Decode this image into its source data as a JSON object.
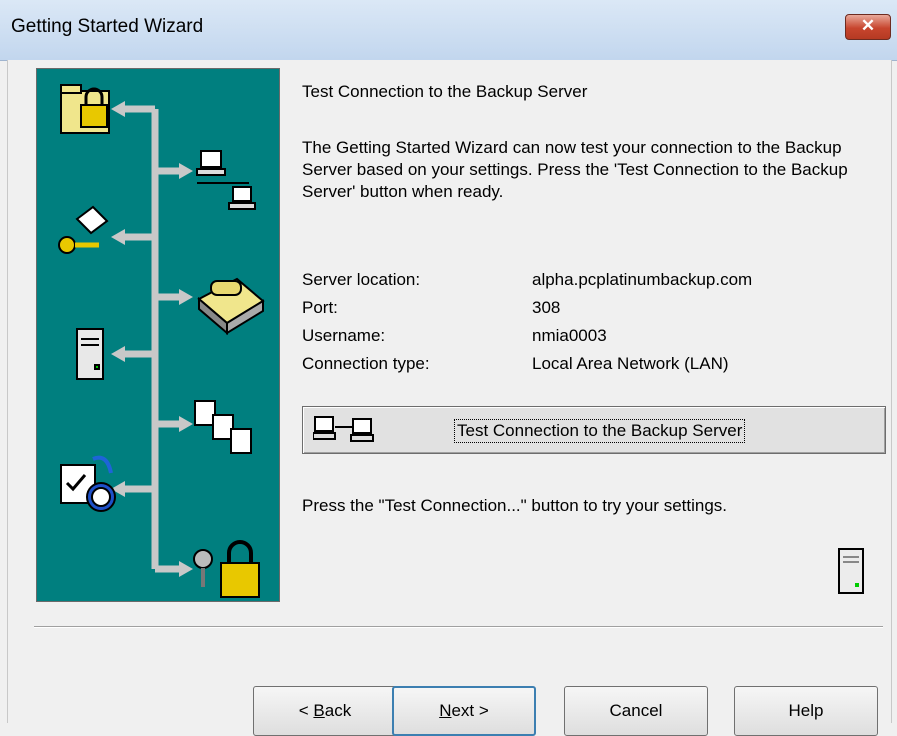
{
  "window": {
    "title": "Getting Started Wizard",
    "close_label": "✕"
  },
  "page": {
    "heading": "Test Connection to the Backup Server",
    "description": "The Getting Started Wizard can now test your connection to the Backup Server based on your settings.  Press the 'Test Connection to the Backup Server' button when ready.",
    "info": [
      {
        "label": "Server location:",
        "value": "alpha.pcplatinumbackup.com"
      },
      {
        "label": "Port:",
        "value": "308"
      },
      {
        "label": "Username:",
        "value": "nmia0003"
      },
      {
        "label": "Connection type:",
        "value": "Local Area Network (LAN)"
      }
    ],
    "test_button_label": "Test Connection to the Backup Server",
    "hint": "Press the \"Test Connection...\" button to try your settings."
  },
  "buttons": {
    "back_prefix": "< ",
    "back_mnemonic": "B",
    "back_rest": "ack",
    "next_mnemonic": "N",
    "next_rest": "ext >",
    "cancel": "Cancel",
    "help": "Help"
  },
  "colors": {
    "panel": "#007f7f",
    "titlebar": "#c2d6ee",
    "close": "#c7452e"
  }
}
